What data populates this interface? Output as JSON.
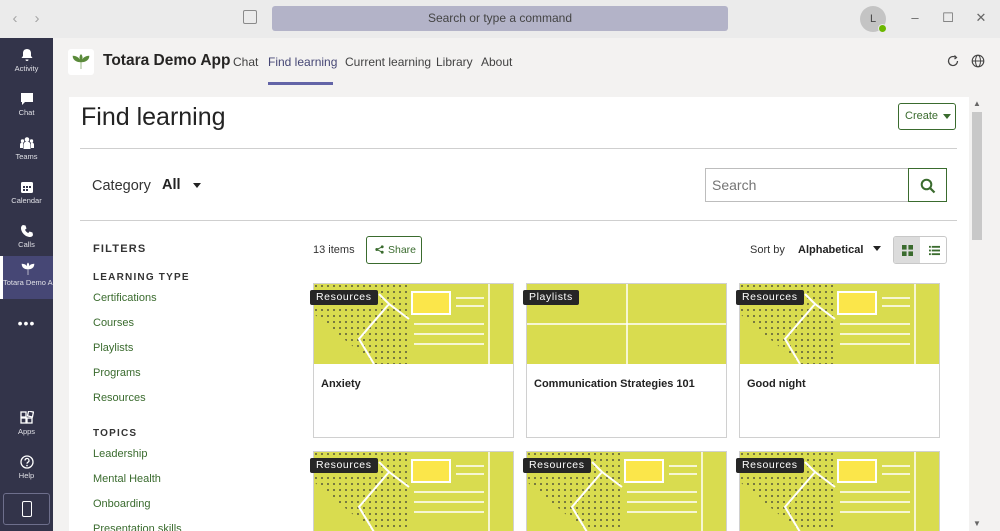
{
  "titlebar": {
    "search_placeholder": "Search or type a command",
    "avatar_initial": "L"
  },
  "rail": {
    "items": [
      {
        "label": "Activity"
      },
      {
        "label": "Chat"
      },
      {
        "label": "Teams"
      },
      {
        "label": "Calendar"
      },
      {
        "label": "Calls"
      },
      {
        "label": "Totara Demo App"
      },
      {
        "label": "Apps"
      },
      {
        "label": "Help"
      }
    ],
    "more": "•••"
  },
  "app": {
    "name": "Totara Demo App",
    "tabs": [
      {
        "label": "Chat"
      },
      {
        "label": "Find learning"
      },
      {
        "label": "Current learning"
      },
      {
        "label": "Library"
      },
      {
        "label": "About"
      }
    ],
    "active_tab": "Find learning"
  },
  "page": {
    "title": "Find learning",
    "create_label": "Create",
    "category_label": "Category",
    "category_value": "All",
    "search_placeholder": "Search",
    "items_count": "13 items",
    "share_label": "Share",
    "sort_label": "Sort by",
    "sort_value": "Alphabetical"
  },
  "filters": {
    "heading": "FILTERS",
    "learning_type": {
      "heading": "LEARNING TYPE",
      "items": [
        "Certifications",
        "Courses",
        "Playlists",
        "Programs",
        "Resources"
      ]
    },
    "topics": {
      "heading": "TOPICS",
      "items": [
        "Leadership",
        "Mental Health",
        "Onboarding",
        "Presentation skills"
      ]
    }
  },
  "cards": [
    {
      "badge": "Resources",
      "title": "Anxiety",
      "art": "resource"
    },
    {
      "badge": "Playlists",
      "title": "Communication Strategies 101",
      "art": "playlist"
    },
    {
      "badge": "Resources",
      "title": "Good night",
      "art": "resource"
    },
    {
      "badge": "Resources",
      "title": "",
      "art": "resource"
    },
    {
      "badge": "Resources",
      "title": "",
      "art": "resource"
    },
    {
      "badge": "Resources",
      "title": "",
      "art": "resource"
    }
  ],
  "colors": {
    "accent_green": "#3a6b2e",
    "teams_purple": "#6264a7",
    "rail_bg": "#33344a",
    "card_art": "#d9dc4f",
    "card_art_highlight": "#fbe64a"
  }
}
